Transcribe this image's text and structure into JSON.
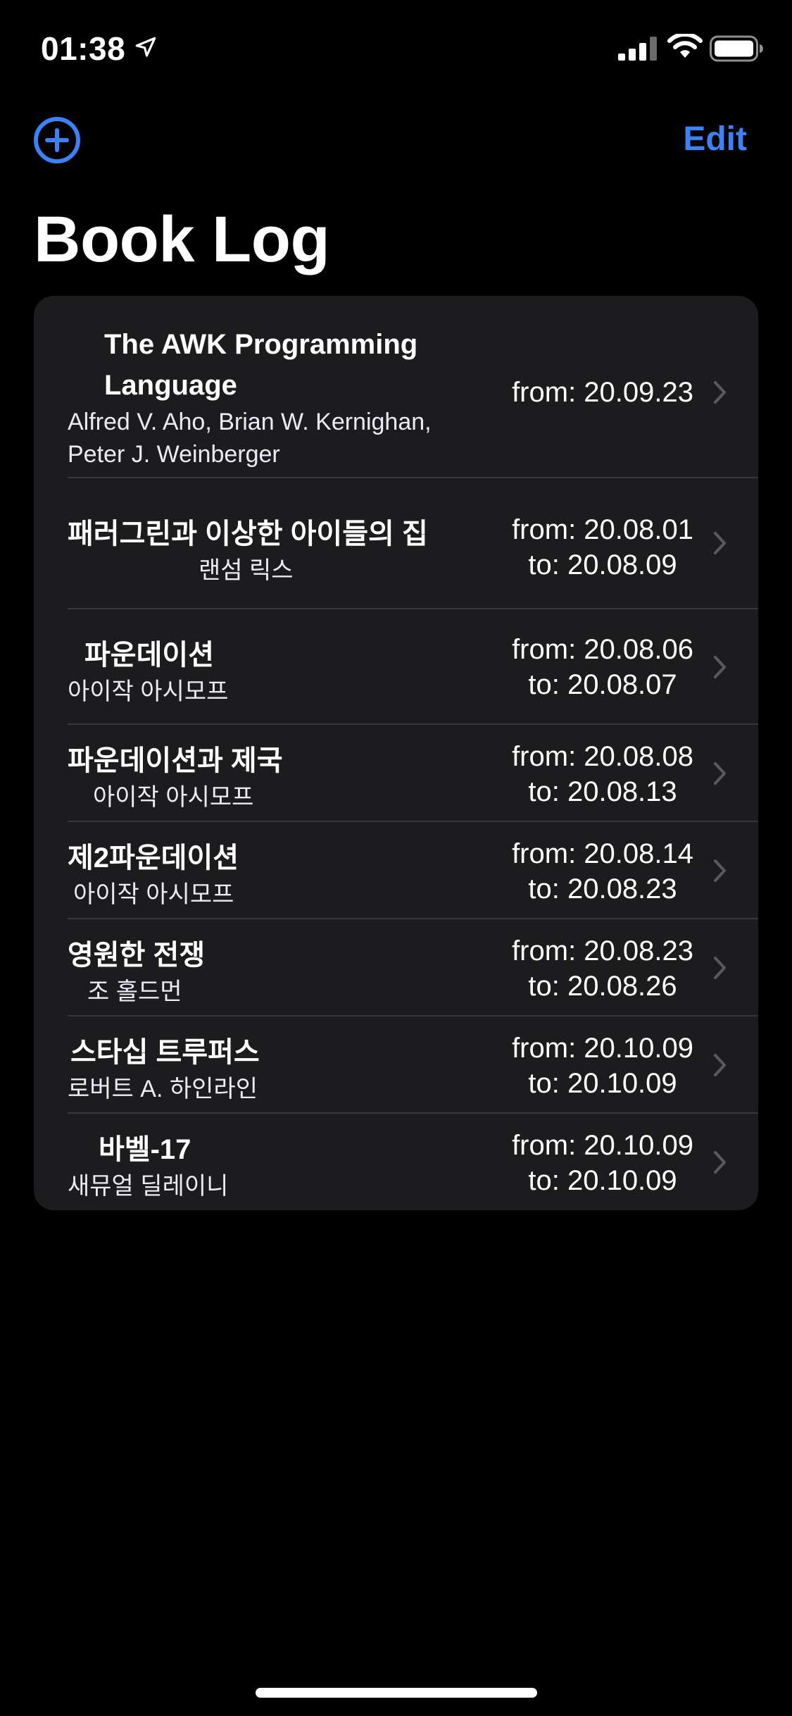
{
  "status_bar": {
    "time": "01:38"
  },
  "nav": {
    "edit_label": "Edit"
  },
  "page": {
    "title": "Book Log"
  },
  "books": [
    {
      "title": "The AWK Programming Language",
      "title_line1": "The AWK Programming",
      "title_line2": "Language",
      "author": "Alfred V. Aho, Brian W. Kernighan, Peter J. Weinberger",
      "author_line1": "Alfred V. Aho, Brian W. Kernighan,",
      "author_line2": "Peter J. Weinberger",
      "from": "from: 20.09.23",
      "to": ""
    },
    {
      "title": "패러그린과 이상한 아이들의 집",
      "author": "랜섬 릭스",
      "from": "from: 20.08.01",
      "to": "to: 20.08.09"
    },
    {
      "title": "파운데이션",
      "author": "아이작 아시모프",
      "from": "from: 20.08.06",
      "to": "to: 20.08.07"
    },
    {
      "title": "파운데이션과 제국",
      "author": "아이작 아시모프",
      "from": "from: 20.08.08",
      "to": "to: 20.08.13"
    },
    {
      "title": "제2파운데이션",
      "author": "아이작 아시모프",
      "from": "from: 20.08.14",
      "to": "to: 20.08.23"
    },
    {
      "title": "영원한 전쟁",
      "author": "조 홀드먼",
      "from": "from: 20.08.23",
      "to": "to: 20.08.26"
    },
    {
      "title": "스타십 트루퍼스",
      "author": "로버트 A. 하인라인",
      "from": "from: 20.10.09",
      "to": "to: 20.10.09"
    },
    {
      "title": "바벨-17",
      "author": "새뮤얼 딜레이니",
      "from": "from: 20.10.09",
      "to": "to: 20.10.09"
    }
  ],
  "colors": {
    "accent": "#3a82f6",
    "cell_background": "#1c1c1e",
    "separator": "#38383a"
  }
}
